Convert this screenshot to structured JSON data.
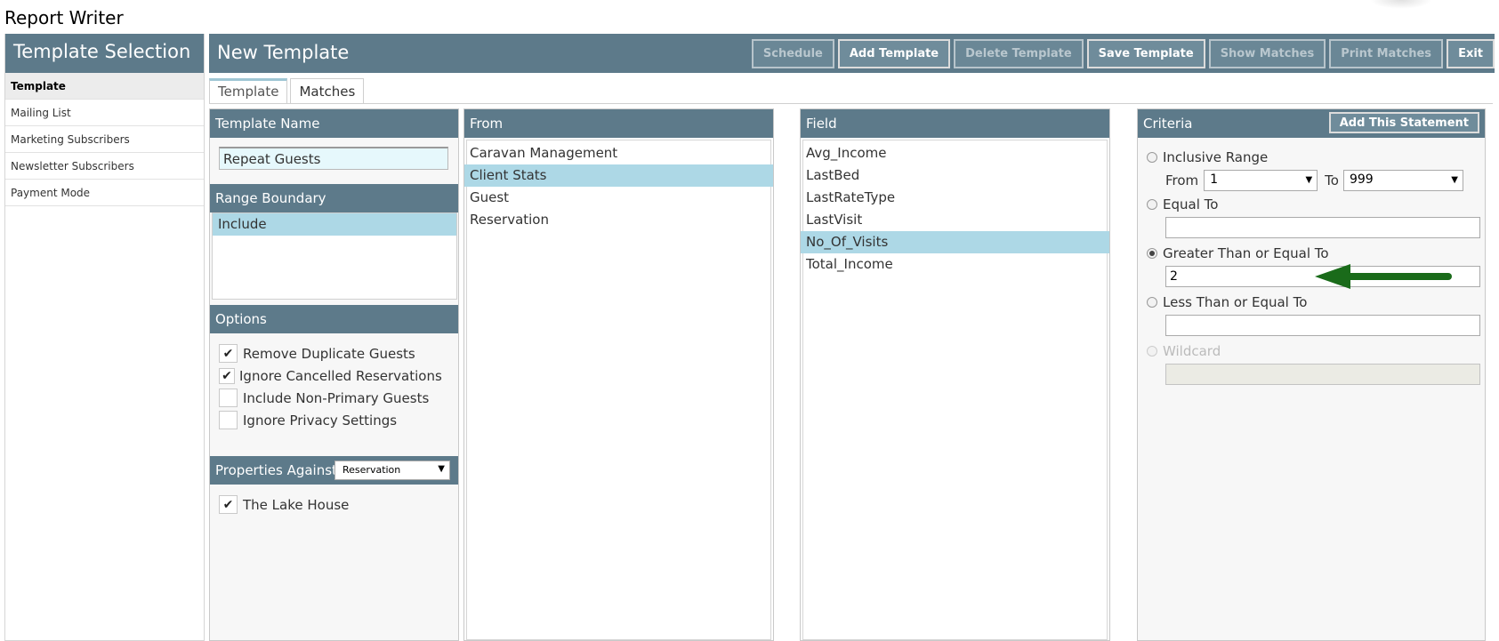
{
  "app": {
    "title": "Report Writer"
  },
  "sidebar": {
    "title": "Template Selection",
    "items": [
      {
        "label": "Template",
        "active": true
      },
      {
        "label": "Mailing List"
      },
      {
        "label": "Marketing Subscribers"
      },
      {
        "label": "Newsletter Subscribers"
      },
      {
        "label": "Payment Mode"
      }
    ]
  },
  "header": {
    "title": "New Template",
    "buttons": {
      "schedule": "Schedule",
      "add_template": "Add Template",
      "delete_template": "Delete Template",
      "save_template": "Save Template",
      "show_matches": "Show Matches",
      "print_matches": "Print Matches",
      "exit": "Exit"
    }
  },
  "tabs": {
    "template": "Template",
    "matches": "Matches"
  },
  "template_name": {
    "heading": "Template Name",
    "value": "Repeat Guests"
  },
  "range_boundary": {
    "heading": "Range Boundary",
    "items": [
      "Include"
    ]
  },
  "options": {
    "heading": "Options",
    "items": [
      {
        "label": "Remove Duplicate Guests",
        "checked": true
      },
      {
        "label": "Ignore Cancelled Reservations",
        "checked": true
      },
      {
        "label": "Include Non-Primary Guests",
        "checked": false
      },
      {
        "label": "Ignore Privacy Settings",
        "checked": false
      }
    ]
  },
  "properties": {
    "heading": "Properties Against",
    "selected": "Reservation",
    "items": [
      {
        "label": "The Lake House",
        "checked": true
      }
    ]
  },
  "from": {
    "heading": "From",
    "items": [
      "Caravan Management",
      "Client Stats",
      "Guest",
      "Reservation"
    ],
    "selected": "Client Stats"
  },
  "field": {
    "heading": "Field",
    "items": [
      "Avg_Income",
      "LastBed",
      "LastRateType",
      "LastVisit",
      "No_Of_Visits",
      "Total_Income"
    ],
    "selected": "No_Of_Visits"
  },
  "criteria": {
    "heading": "Criteria",
    "add_button": "Add This Statement",
    "inclusive_range": "Inclusive Range",
    "from_label": "From",
    "from_value": "1",
    "to_label": "To",
    "to_value": "999",
    "equal_to": "Equal To",
    "equal_to_value": "",
    "greater_than": "Greater Than or Equal To",
    "greater_than_value": "2",
    "less_than": "Less Than or Equal To",
    "less_than_value": "",
    "wildcard": "Wildcard",
    "selected": "Greater Than or Equal To"
  },
  "colors": {
    "header": "#5d7a8a",
    "selection": "#add8e6",
    "annotation_arrow": "#1a6b1a"
  }
}
